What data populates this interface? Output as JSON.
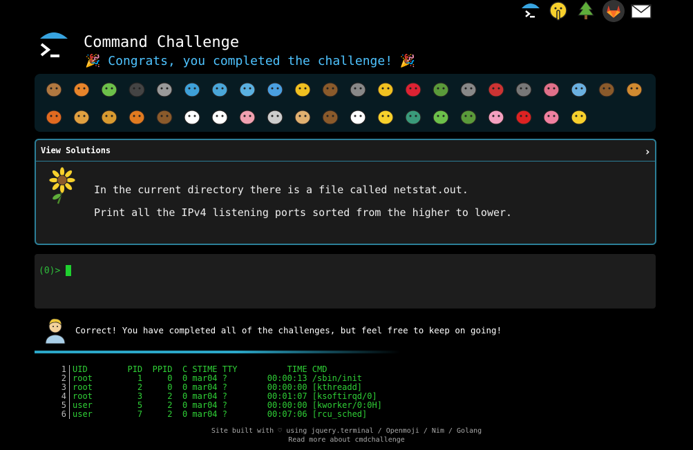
{
  "header": {
    "title": "Command Challenge",
    "congrats_text": "Congrats, you completed the challenge!",
    "party_icon": "🎉"
  },
  "top_icons": [
    "umbrella-prompt-icon",
    "shushing-face-icon",
    "evergreen-tree-icon",
    "gitlab-icon",
    "envelope-icon"
  ],
  "animals_row1": [
    "snail",
    "butterfly",
    "caterpillar",
    "ant",
    "spider-web",
    "whale",
    "shark",
    "dolphin",
    "fish",
    "tropical-fish",
    "otter",
    "wolf",
    "bee",
    "ladybug",
    "cricket",
    "mosquito",
    "scorpion",
    "fly",
    "worm",
    "microbe",
    "chimpanzee",
    "dog"
  ],
  "animals_row2": [
    "fox",
    "cat",
    "lion",
    "tiger",
    "horse",
    "unicorn",
    "cow",
    "pig",
    "mouse",
    "hamster",
    "bear",
    "panda",
    "hatching-chick",
    "peacock",
    "frog",
    "dragon",
    "cherry-blossom",
    "rose",
    "hibiscus",
    "sunflower"
  ],
  "solutions": {
    "toggle_label": "View Solutions",
    "chevron": "›",
    "task_line1": "In the current directory there is a file called netstat.out.",
    "task_line2": "Print all the IPv4 listening ports sorted from the higher to lower."
  },
  "terminal": {
    "prompt": "(0)>"
  },
  "result": {
    "message": "Correct! You have completed all of the challenges, but feel free to keep on going!"
  },
  "file_preview": [
    {
      "num": "1",
      "text": "UID        PID  PPID  C STIME TTY          TIME CMD"
    },
    {
      "num": "2",
      "text": "root         1     0  0 mar04 ?        00:00:13 /sbin/init"
    },
    {
      "num": "3",
      "text": "root         2     0  0 mar04 ?        00:00:00 [kthreadd]"
    },
    {
      "num": "4",
      "text": "root         3     2  0 mar04 ?        00:01:07 [ksoftirqd/0]"
    },
    {
      "num": "5",
      "text": "user         5     2  0 mar04 ?        00:00:00 [kworker/0:0H]"
    },
    {
      "num": "6",
      "text": "user         7     2  0 mar04 ?        00:07:06 [rcu_sched]"
    }
  ],
  "footer": {
    "line1": "Site built with ♡ using jquery.terminal / Openmoji / Nim / Golang",
    "line2": "Read more about cmdchallenge"
  },
  "colors": {
    "accent": "#2c7f98",
    "congrats": "#4ec3ff",
    "terminal_green": "#2fd036"
  }
}
